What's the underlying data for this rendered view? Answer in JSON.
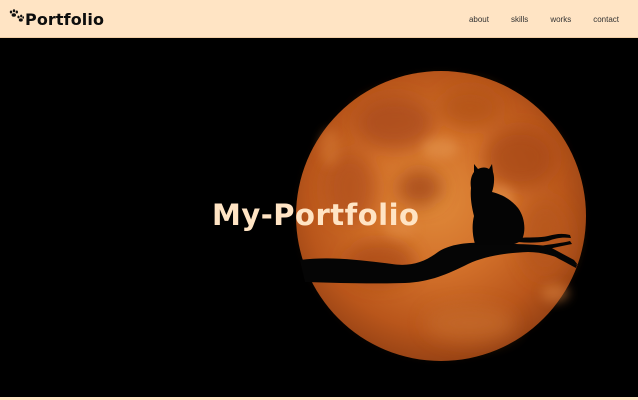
{
  "header": {
    "logo_text": "Portfolio",
    "logo_icon": "paw-icon",
    "bg_color": "#ffe4c4"
  },
  "nav": {
    "items": [
      {
        "label": "about"
      },
      {
        "label": "skills"
      },
      {
        "label": "works"
      },
      {
        "label": "contact"
      }
    ]
  },
  "hero": {
    "title": "My-Portfolio",
    "title_color": "#ffe4c4",
    "background": "moon-with-cat-silhouette"
  }
}
